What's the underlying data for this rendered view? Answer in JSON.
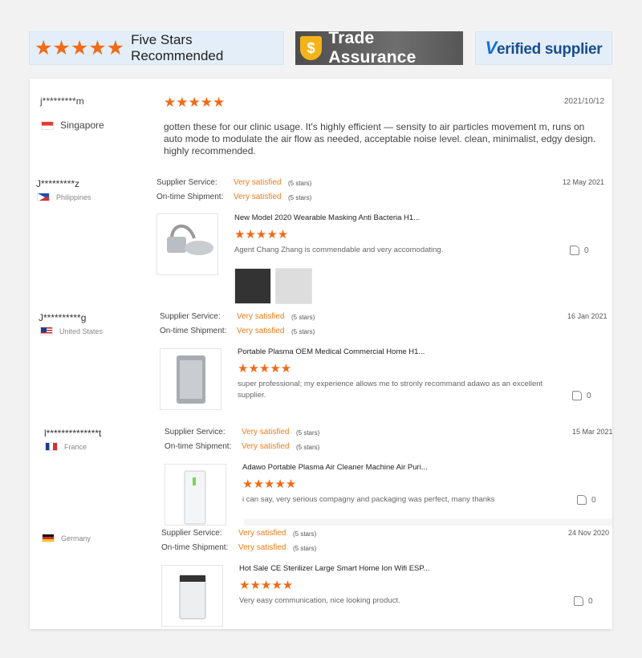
{
  "badges": {
    "five_stars": {
      "stars": "★★★★★",
      "label": "Five Stars Recommended"
    },
    "trade": {
      "label": "Trade Assurance",
      "icon": "$"
    },
    "verified": {
      "label": "erified supplier",
      "v": "V"
    }
  },
  "featured": {
    "user": "j*********m",
    "country": "Singapore",
    "date": "2021/10/12",
    "stars": "★★★★★",
    "comment": "gotten these for our clinic usage. It's highly efficient — sensity to air particles movement m, runs on auto mode to modulate the air flow as needed, acceptable noise level. clean, minimalist, edgy design. highly recommended."
  },
  "labels": {
    "supplier_service": "Supplier Service:",
    "ontime": "On-time Shipment:",
    "very_satisfied": "Very satisfied",
    "five_stars": "(5 stars)"
  },
  "reviews": [
    {
      "user": "J*********z",
      "country": "Philippines",
      "date": "12 May 2021",
      "product": "New Model 2020 Wearable Masking Anti Bacteria H1...",
      "stars": "★★★★★",
      "comment": "Agent Chang Zhang is commendable and very accomodating.",
      "likes": "0"
    },
    {
      "user": "J**********g",
      "country": "United States",
      "date": "16 Jan 2021",
      "product": "Portable Plasma OEM Medical Commercial Home H1...",
      "stars": "★★★★★",
      "comment": "super professional; my experience allows me to stronly recommand adawo as an excellent supplier.",
      "likes": "0"
    },
    {
      "user": "l**************t",
      "country": "France",
      "date": "15 Mar 2021",
      "product": "Adawo Portable Plasma Air Cleaner Machine Air Puri...",
      "stars": "★★★★★",
      "comment": "i can say, very serious compagny and packaging was perfect, many thanks",
      "likes": "0"
    },
    {
      "user": "",
      "country": "Germany",
      "date": "24 Nov 2020",
      "product": "Hot Sale CE Sterilizer Large Smart Home Ion Wifi ESP...",
      "stars": "★★★★★",
      "comment": "Very easy communication, nice looking product.",
      "likes": "0"
    }
  ],
  "colors": {
    "accent": "#f06b17",
    "orange_text": "#f07b17"
  }
}
